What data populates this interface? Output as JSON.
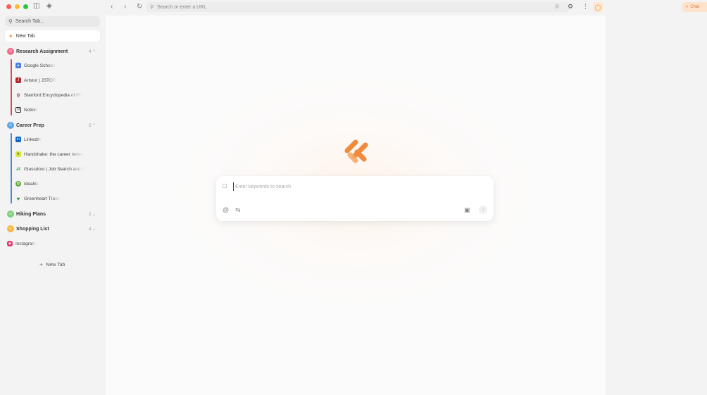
{
  "sidebar": {
    "search_placeholder": "Search Tab...",
    "active_tab_label": "New Tab",
    "groups": [
      {
        "name": "Research Assignment",
        "count": "4",
        "color": "#f06a8a",
        "line_color": "#e0445c",
        "tabs": [
          {
            "label": "Google Scholar",
            "icon": "google-scholar-icon",
            "color": "#4a7fe5"
          },
          {
            "label": "Artstor | JSTOR",
            "icon": "jstor-icon",
            "color": "#b5232f"
          },
          {
            "label": "Stanford Encyclopedia of Phi",
            "icon": "stanford-icon",
            "color": "#8c1515"
          },
          {
            "label": "Notion",
            "icon": "notion-icon",
            "color": "#222222"
          }
        ]
      },
      {
        "name": "Career Prep",
        "count": "5",
        "color": "#5aa5e8",
        "line_color": "#3b8ede",
        "tabs": [
          {
            "label": "LinkedIn",
            "icon": "linkedin-icon",
            "color": "#0a66c2"
          },
          {
            "label": "Handshake: the career netwo",
            "icon": "handshake-icon",
            "color": "#d8e93a"
          },
          {
            "label": "Glassdoor | Job Search and C",
            "icon": "glassdoor-icon",
            "color": "#0caa41"
          },
          {
            "label": "Idealist",
            "icon": "idealist-icon",
            "color": "#6aaa3a"
          },
          {
            "label": "Greenheart Travel",
            "icon": "greenheart-icon",
            "color": "#2a9a3a"
          }
        ]
      },
      {
        "name": "Hiking Plans",
        "count": "2",
        "color": "#7fd07a",
        "tabs": []
      },
      {
        "name": "Shopping List",
        "count": "4",
        "color": "#f5b942",
        "tabs": []
      }
    ],
    "loose_tab": {
      "label": "Instagram",
      "icon": "instagram-icon",
      "color": "#e1306c"
    },
    "new_tab_label": "New Tab"
  },
  "toolbar": {
    "url_placeholder": "Search or enter a URL",
    "chat_label": "Chat"
  },
  "main": {
    "search_placeholder": "Enter keywords to search",
    "accent_color": "#f08a3c"
  }
}
